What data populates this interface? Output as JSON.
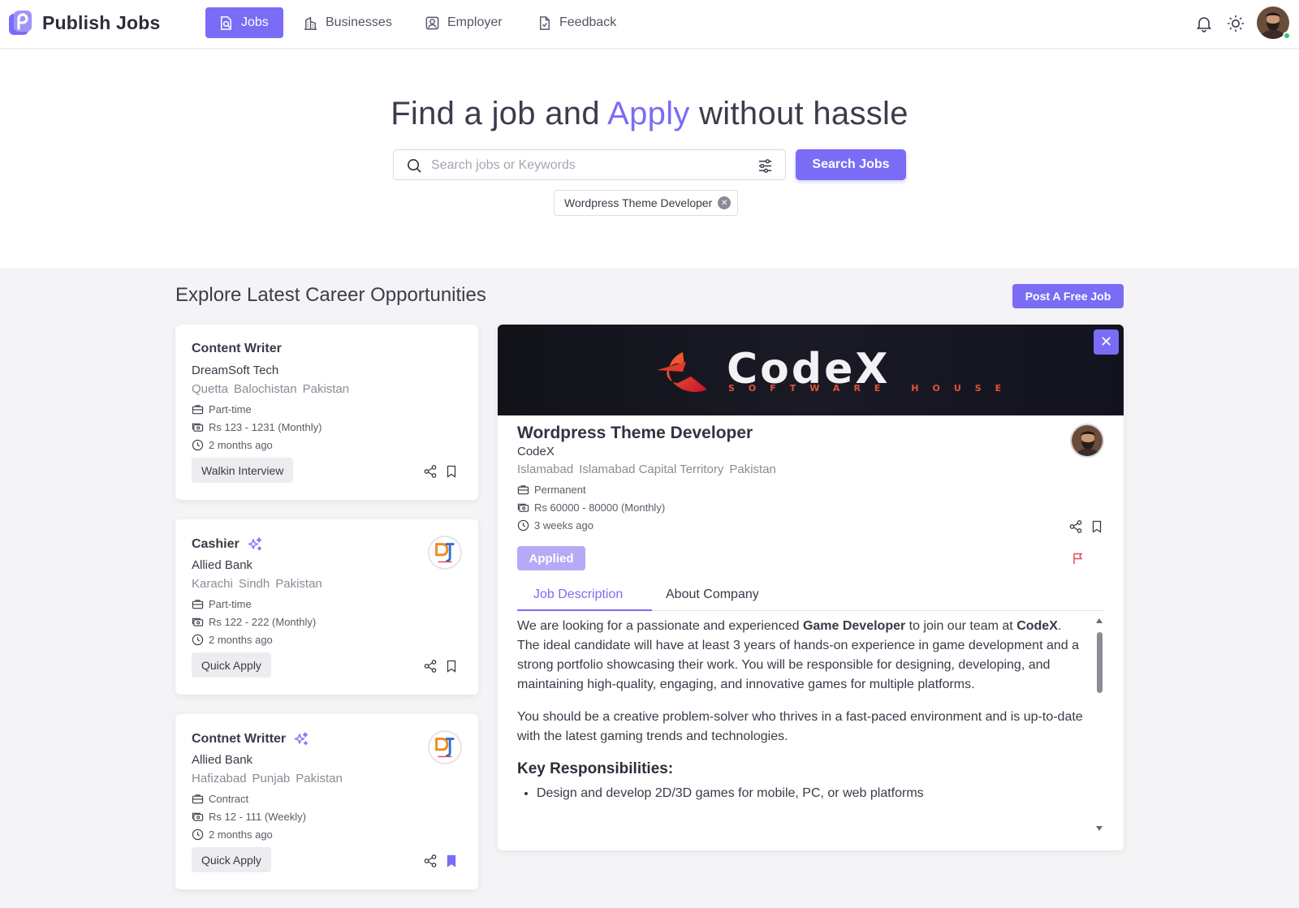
{
  "brand": {
    "name": "Publish Jobs"
  },
  "nav": {
    "items": [
      {
        "label": "Jobs",
        "icon": "job-search-icon",
        "active": true
      },
      {
        "label": "Businesses",
        "icon": "building-icon",
        "active": false
      },
      {
        "label": "Employer",
        "icon": "employer-icon",
        "active": false
      },
      {
        "label": "Feedback",
        "icon": "feedback-icon",
        "active": false
      }
    ],
    "right_icons": [
      "bell-icon",
      "sun-icon",
      "avatar"
    ]
  },
  "hero": {
    "title_before": "Find a job and",
    "title_accent": "Apply",
    "title_after": "without hassle",
    "search_placeholder": "Search jobs or Keywords",
    "search_button": "Search Jobs",
    "active_filter": "Wordpress Theme Developer"
  },
  "section": {
    "title": "Explore Latest Career Opportunities",
    "post_button": "Post A Free Job"
  },
  "jobs": [
    {
      "title": "Content Writer",
      "company": "DreamSoft Tech",
      "location": [
        "Quetta",
        "Balochistan",
        "Pakistan"
      ],
      "type": "Part-time",
      "salary": "Rs 123 - 1231 (Monthly)",
      "posted": "2 months ago",
      "action": "Walkin Interview",
      "featured": false,
      "has_logo": false,
      "bookmarked": false
    },
    {
      "title": "Cashier",
      "company": "Allied Bank",
      "location": [
        "Karachi",
        "Sindh",
        "Pakistan"
      ],
      "type": "Part-time",
      "salary": "Rs 122 - 222 (Monthly)",
      "posted": "2 months ago",
      "action": "Quick Apply",
      "featured": true,
      "has_logo": true,
      "bookmarked": false
    },
    {
      "title": "Contnet Writter",
      "company": "Allied Bank",
      "location": [
        "Hafizabad",
        "Punjab",
        "Pakistan"
      ],
      "type": "Contract",
      "salary": "Rs 12 - 111 (Weekly)",
      "posted": "2 months ago",
      "action": "Quick Apply",
      "featured": true,
      "has_logo": true,
      "bookmarked": true
    }
  ],
  "detail": {
    "banner_logo_text": "CodeX",
    "banner_tagline": "SOFTWARE HOUSE",
    "title": "Wordpress Theme Developer",
    "company": "CodeX",
    "location": [
      "Islamabad",
      "Islamabad Capital Territory",
      "Pakistan"
    ],
    "type": "Permanent",
    "salary": "Rs 60000 - 80000 (Monthly)",
    "posted": "3 weeks ago",
    "status_button": "Applied",
    "tabs": [
      "Job Description",
      "About Company"
    ],
    "description": {
      "p1_a": "We are looking for a passionate and experienced ",
      "p1_b": "Game Developer",
      "p1_c": " to join our team at ",
      "p1_d": "CodeX",
      "p1_e": ". The ideal candidate will have at least 3 years of hands-on experience in game development and a strong portfolio showcasing their work. You will be responsible for designing, developing, and maintaining high-quality, engaging, and innovative games for multiple platforms.",
      "p2": "You should be a creative problem-solver who thrives in a fast-paced environment and is up-to-date with the latest gaming trends and technologies.",
      "heading": "Key Responsibilities:",
      "bullets": [
        "Design and develop 2D/3D games for mobile, PC, or web platforms"
      ]
    }
  },
  "colors": {
    "accent": "#7b6cf6",
    "applied": "#b5aaf6",
    "flag": "#e5484d"
  }
}
